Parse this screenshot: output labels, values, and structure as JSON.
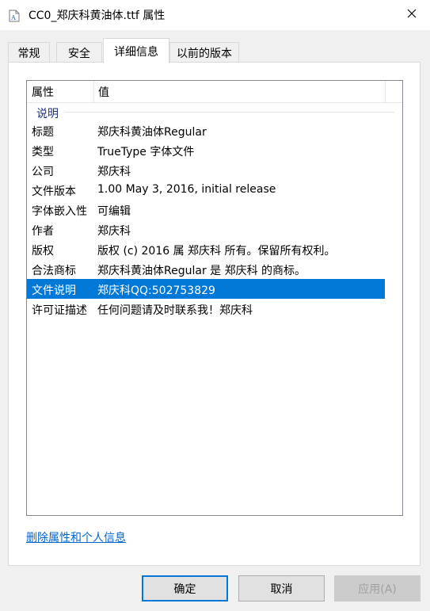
{
  "window": {
    "title": "CC0_郑庆科黄油体.ttf 属性"
  },
  "tabs": [
    {
      "label": "常规",
      "active": false
    },
    {
      "label": "安全",
      "active": false
    },
    {
      "label": "详细信息",
      "active": true
    },
    {
      "label": "以前的版本",
      "active": false
    }
  ],
  "columns": {
    "property": "属性",
    "value": "值"
  },
  "group": {
    "label": "说明"
  },
  "rows": [
    {
      "key": "标题",
      "value": "郑庆科黄油体Regular"
    },
    {
      "key": "类型",
      "value": "TrueType 字体文件"
    },
    {
      "key": "公司",
      "value": "郑庆科"
    },
    {
      "key": "文件版本",
      "value": "1.00 May 3, 2016, initial release"
    },
    {
      "key": "字体嵌入性",
      "value": "可编辑"
    },
    {
      "key": "作者",
      "value": "郑庆科"
    },
    {
      "key": "版权",
      "value": "版权 (c) 2016 属 郑庆科 所有。保留所有权利。"
    },
    {
      "key": "合法商标",
      "value": "郑庆科黄油体Regular 是 郑庆科 的商标。"
    },
    {
      "key": "文件说明",
      "value": "郑庆科QQ:502753829",
      "selected": true
    },
    {
      "key": "许可证描述",
      "value": "任何问题请及时联系我！郑庆科"
    }
  ],
  "remove_link": "删除属性和个人信息",
  "buttons": {
    "ok": "确定",
    "cancel": "取消",
    "apply": "应用(A)"
  },
  "colors": {
    "selection": "#0078d7",
    "group_label": "#1e3287",
    "link": "#0066cc"
  }
}
